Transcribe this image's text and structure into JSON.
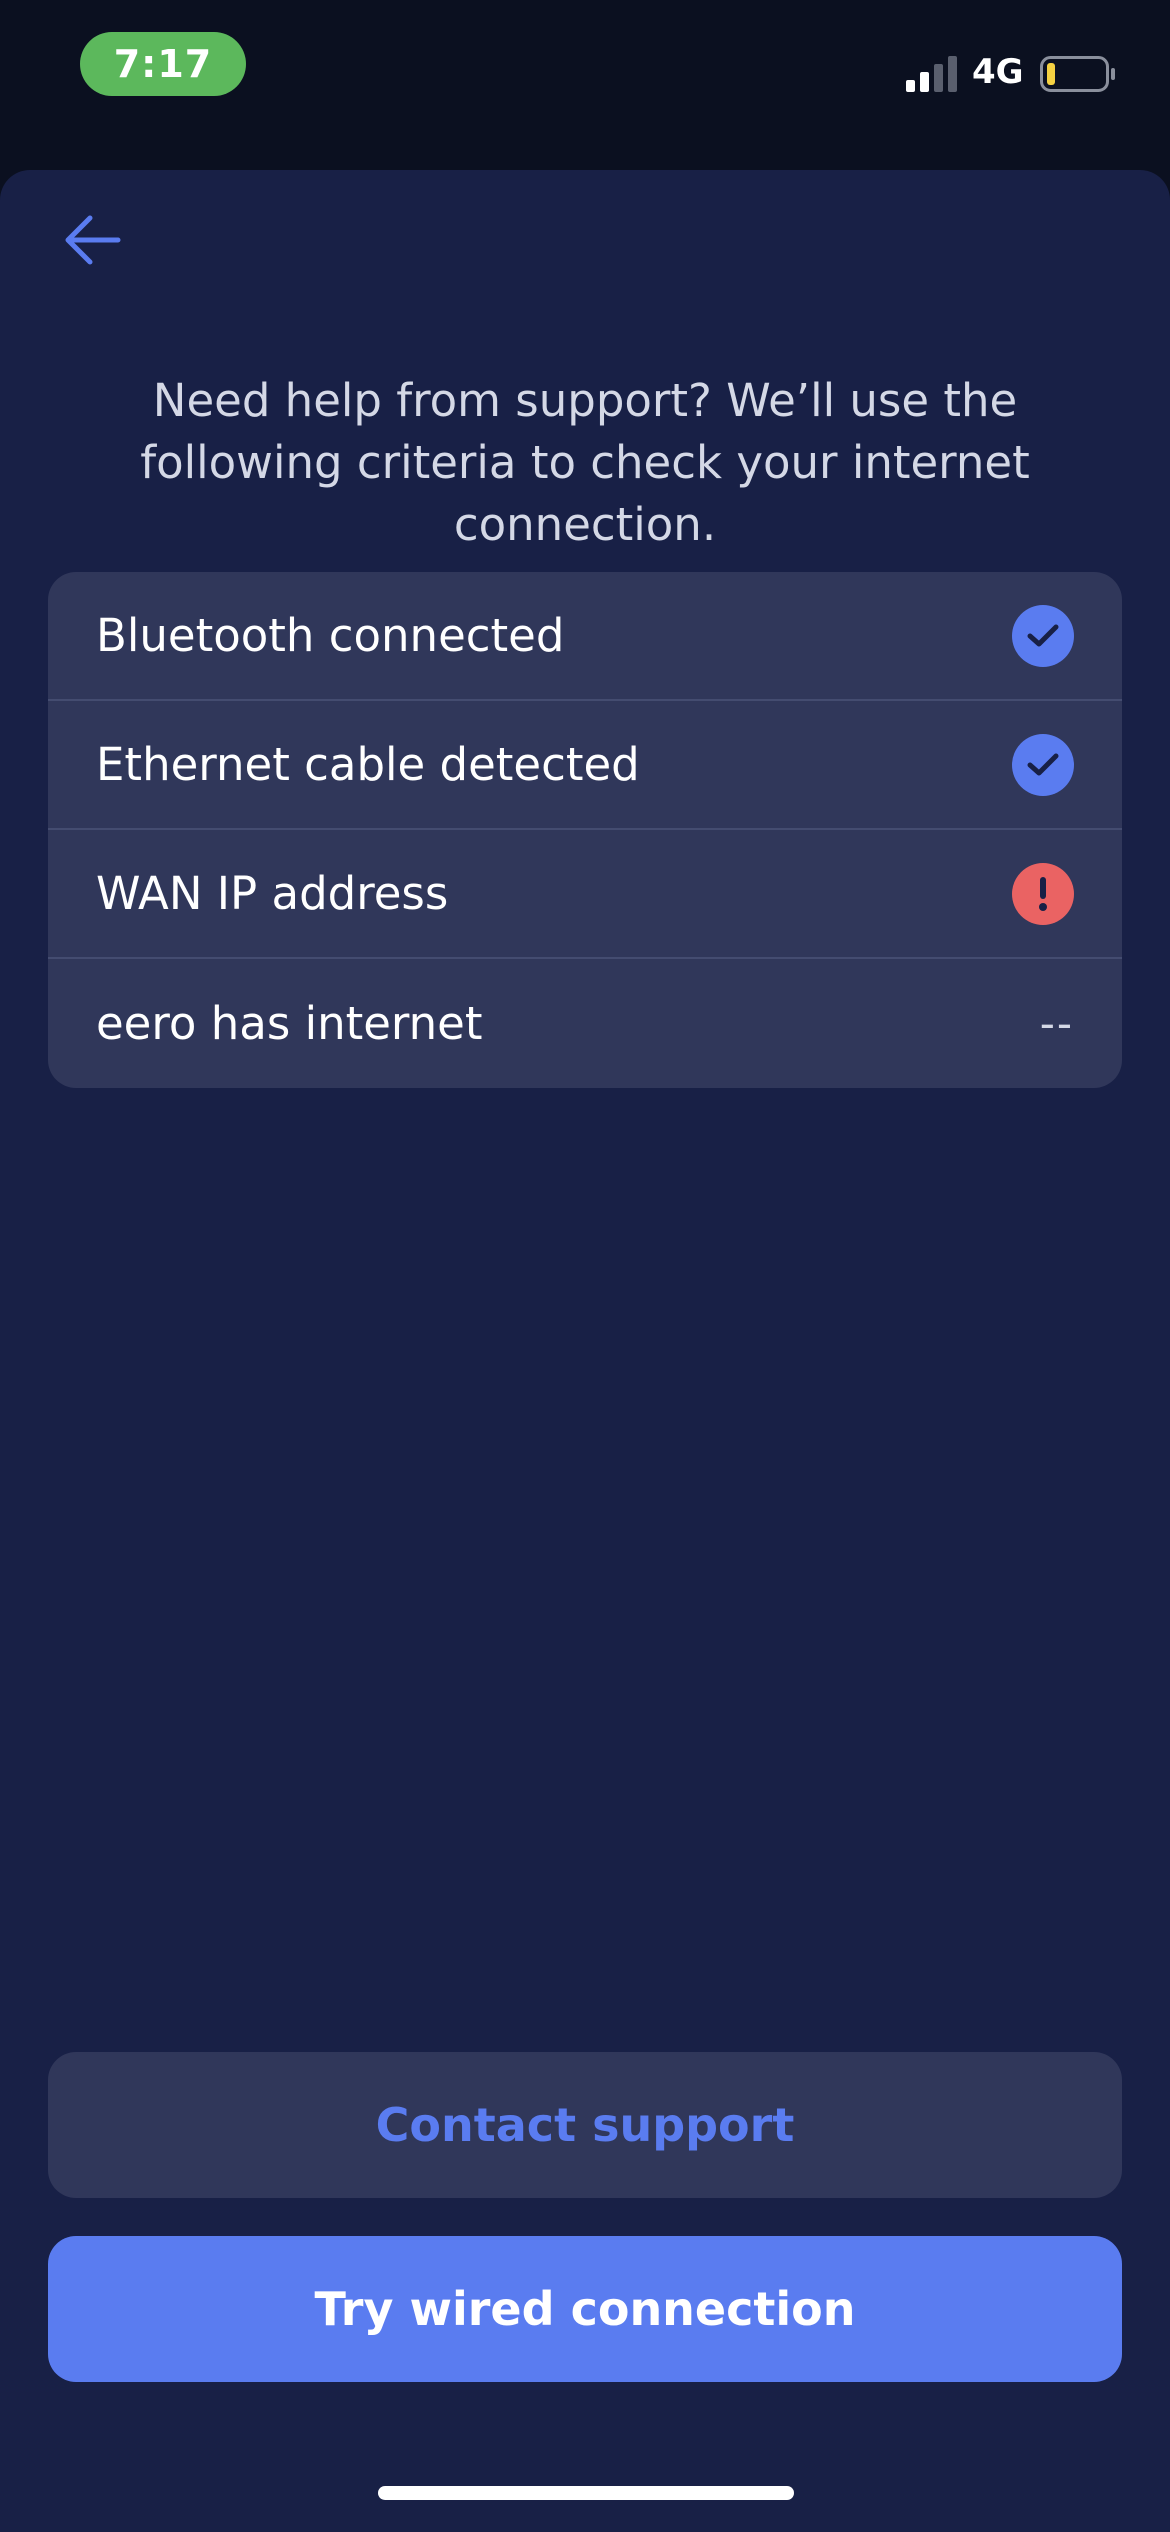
{
  "status_bar": {
    "time": "7:17",
    "network": "4G"
  },
  "intro": {
    "text": "Need help from support? We’ll use the following criteria to check your internet connection."
  },
  "criteria": [
    {
      "label": "Bluetooth connected",
      "status": "check-icon"
    },
    {
      "label": "Ethernet cable detected",
      "status": "check-icon"
    },
    {
      "label": "WAN IP address",
      "status": "exclamation-icon"
    },
    {
      "label": "eero has internet",
      "status_text": "--"
    }
  ],
  "actions": {
    "contact_support": "Contact support",
    "try_wired": "Try wired connection"
  },
  "colors": {
    "accent": "#5a7cf0",
    "error": "#ea6363",
    "time_pill": "#5cb85c",
    "battery_level": "#f5d142",
    "sheet_bg": "#182046",
    "card_bg": "#30375a"
  }
}
